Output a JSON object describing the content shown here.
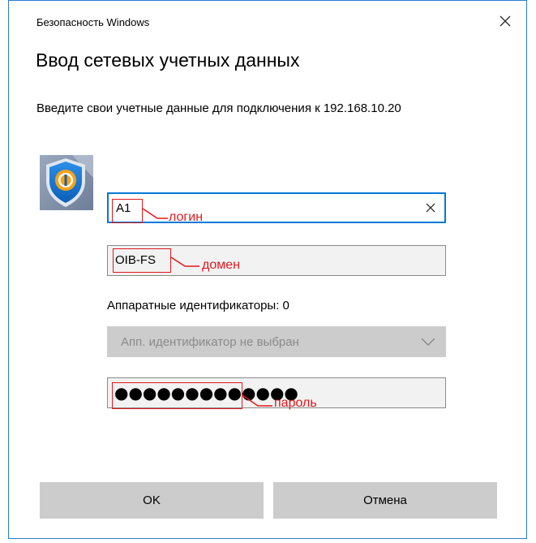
{
  "window": {
    "title": "Безопасность Windows",
    "heading": "Ввод сетевых учетных данных",
    "description": "Введите свои учетные данные для подключения к 192.168.10.20"
  },
  "form": {
    "login_value": "A1",
    "domain_value": "OIB-FS",
    "hw_ids_label": "Аппаратные идентификаторы: 0",
    "hw_select_value": "Апп. идентификатор не выбран",
    "password_masked": "●●●●●●●●●●●●●"
  },
  "annotations": {
    "login": "логин",
    "domain": "домен",
    "password": "пароль",
    "color": "#e0191e"
  },
  "buttons": {
    "ok": "OK",
    "cancel": "Отмена"
  },
  "icons": {
    "close": "close-icon",
    "clear": "clear-icon",
    "shield": "shield-icon",
    "chevron": "chevron-down-icon"
  },
  "colors": {
    "accent": "#0078d7",
    "button_bg": "#cccccc",
    "annotation": "#e0191e"
  }
}
